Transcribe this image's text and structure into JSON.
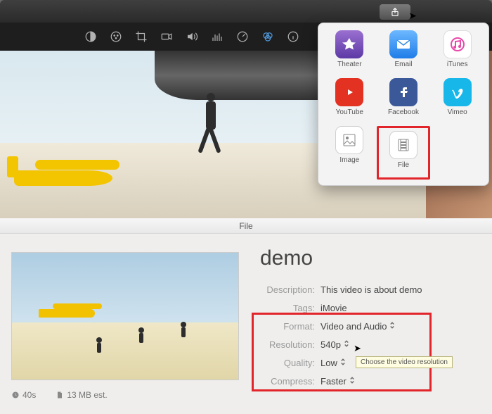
{
  "toolbarIcons": [
    "contrast",
    "palette",
    "crop",
    "camera",
    "volume",
    "equalizer",
    "speed",
    "color-balance",
    "info"
  ],
  "share": {
    "items": [
      {
        "id": "theater",
        "label": "Theater"
      },
      {
        "id": "email",
        "label": "Email"
      },
      {
        "id": "itunes",
        "label": "iTunes"
      },
      {
        "id": "youtube",
        "label": "YouTube"
      },
      {
        "id": "facebook",
        "label": "Facebook"
      },
      {
        "id": "vimeo",
        "label": "Vimeo"
      },
      {
        "id": "image",
        "label": "Image"
      },
      {
        "id": "file",
        "label": "File"
      }
    ],
    "highlighted": "file"
  },
  "panel": {
    "header": "File",
    "title": "demo",
    "fields": {
      "description": {
        "label": "Description:",
        "value": "This video is about demo"
      },
      "tags": {
        "label": "Tags:",
        "value": "iMovie"
      },
      "format": {
        "label": "Format:",
        "value": "Video and Audio"
      },
      "resolution": {
        "label": "Resolution:",
        "value": "540p"
      },
      "quality": {
        "label": "Quality:",
        "value": "Low"
      },
      "compress": {
        "label": "Compress:",
        "value": "Faster"
      }
    },
    "meta": {
      "duration": "40s",
      "size": "13 MB est."
    },
    "tooltip": "Choose the video resolution"
  }
}
